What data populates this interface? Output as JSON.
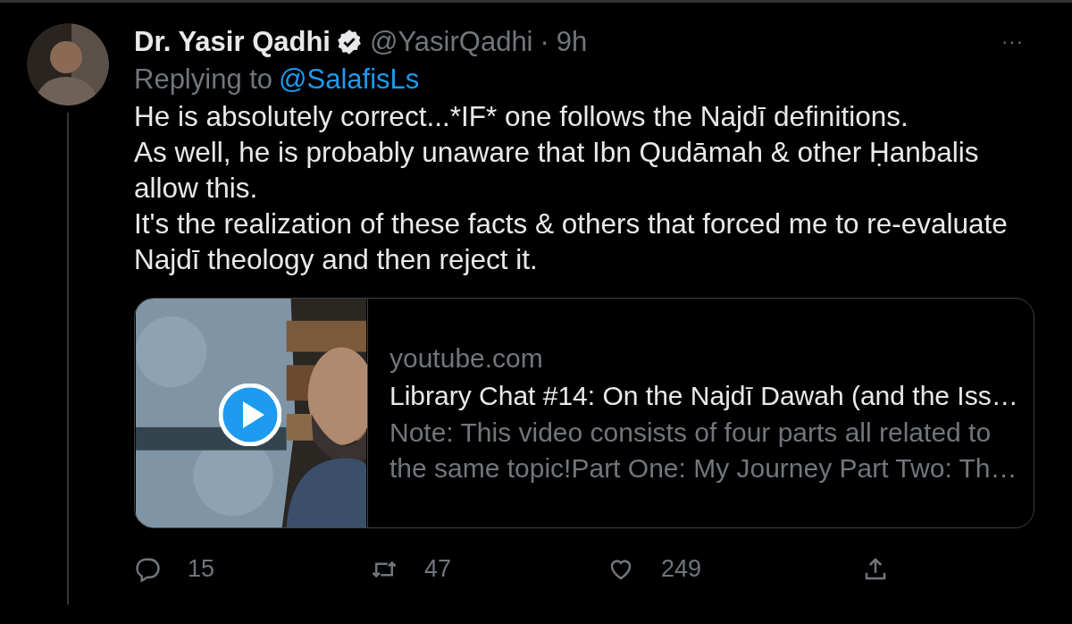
{
  "tweet": {
    "author": {
      "name": "Dr. Yasir Qadhi",
      "verified": true,
      "handle": "@YasirQadhi",
      "separator": "·",
      "time": "9h"
    },
    "more": "···",
    "replying_label": "Replying to",
    "replying_to": "@SalafisLs",
    "body_lines": [
      "He is absolutely correct...*IF* one follows the Najdī definitions.",
      "As well, he is probably unaware that Ibn Qudāmah & other Ḥanbalis allow this.",
      "It's the realization of these facts & others that forced me to re-evaluate Najdī theology and then reject it."
    ],
    "card": {
      "thumbnail": {
        "kind": "picture"
      },
      "domain": "youtube.com",
      "title": "Library Chat #14: On the Najdī Dawah (and the Iss…",
      "description_lines": [
        "Note: This video consists of four parts all related to",
        "the same topic!Part One: My Journey Part Two: Th…"
      ]
    },
    "actions": [
      {
        "kind": "reply",
        "count": "15"
      },
      {
        "kind": "retweet",
        "count": "47"
      },
      {
        "kind": "like",
        "count": "249"
      },
      {
        "kind": "share"
      }
    ]
  }
}
